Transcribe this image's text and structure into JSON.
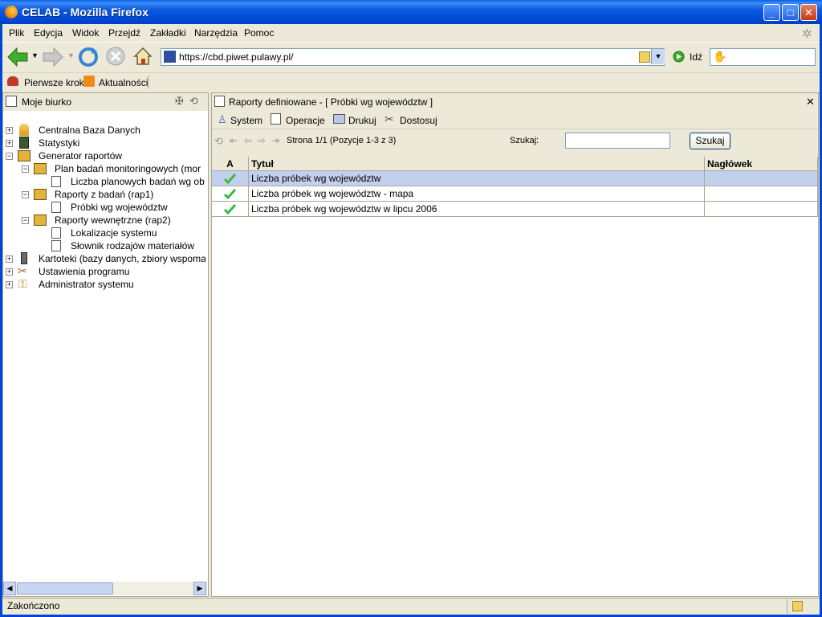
{
  "window": {
    "title": "CELAB - Mozilla Firefox"
  },
  "menu": [
    {
      "label": "Plik"
    },
    {
      "label": "Edycja"
    },
    {
      "label": "Widok"
    },
    {
      "label": "Przejdź"
    },
    {
      "label": "Zakładki"
    },
    {
      "label": "Narzędzia"
    },
    {
      "label": "Pomoc"
    }
  ],
  "navbar": {
    "url": "https://cbd.piwet.pulawy.pl/",
    "go_label": "Idź"
  },
  "bookmarks": [
    {
      "label": "Pierwsze kroki"
    },
    {
      "label": "Aktualności"
    }
  ],
  "left_panel": {
    "title": "Moje biurko",
    "tree": [
      {
        "label": "Centralna Baza Danych"
      },
      {
        "label": "Statystyki"
      },
      {
        "label": "Generator raportów"
      },
      {
        "label": "Plan badań monitoringowych (mor"
      },
      {
        "label": "Liczba planowych badań wg ob"
      },
      {
        "label": "Raporty z badań (rap1)"
      },
      {
        "label": "Próbki wg województw"
      },
      {
        "label": "Raporty wewnętrzne (rap2)"
      },
      {
        "label": "Lokalizacje systemu"
      },
      {
        "label": "Słownik rodzajów materiałów"
      },
      {
        "label": "Kartoteki (bazy danych, zbiory wspoma"
      },
      {
        "label": "Ustawienia programu"
      },
      {
        "label": "Administrator systemu"
      }
    ]
  },
  "right_panel": {
    "title": "Raporty definiowane - [ Próbki wg województw ]",
    "toolbar": [
      {
        "label": "System"
      },
      {
        "label": "Operacje"
      },
      {
        "label": "Drukuj"
      },
      {
        "label": "Dostosuj"
      }
    ],
    "pager": {
      "text": "Strona 1/1 (Pozycje 1-3 z 3)",
      "search_label": "Szukaj:",
      "search_value": "",
      "search_button": "Szukaj"
    },
    "grid": {
      "headers": [
        "A",
        "Tytuł",
        "Nagłówek"
      ],
      "rows": [
        {
          "title": "Liczba próbek wg województw",
          "header": "",
          "active": true
        },
        {
          "title": "Liczba próbek wg województw - mapa",
          "header": "",
          "active": true
        },
        {
          "title": "Liczba próbek wg województw w lipcu 2006",
          "header": "",
          "active": true
        }
      ]
    }
  },
  "status": {
    "text": "Zakończono"
  },
  "colors": {
    "title_bar": "#0054e3",
    "selection": "#c2d0ee",
    "chrome": "#ece9d8",
    "check": "#3cb83c"
  }
}
